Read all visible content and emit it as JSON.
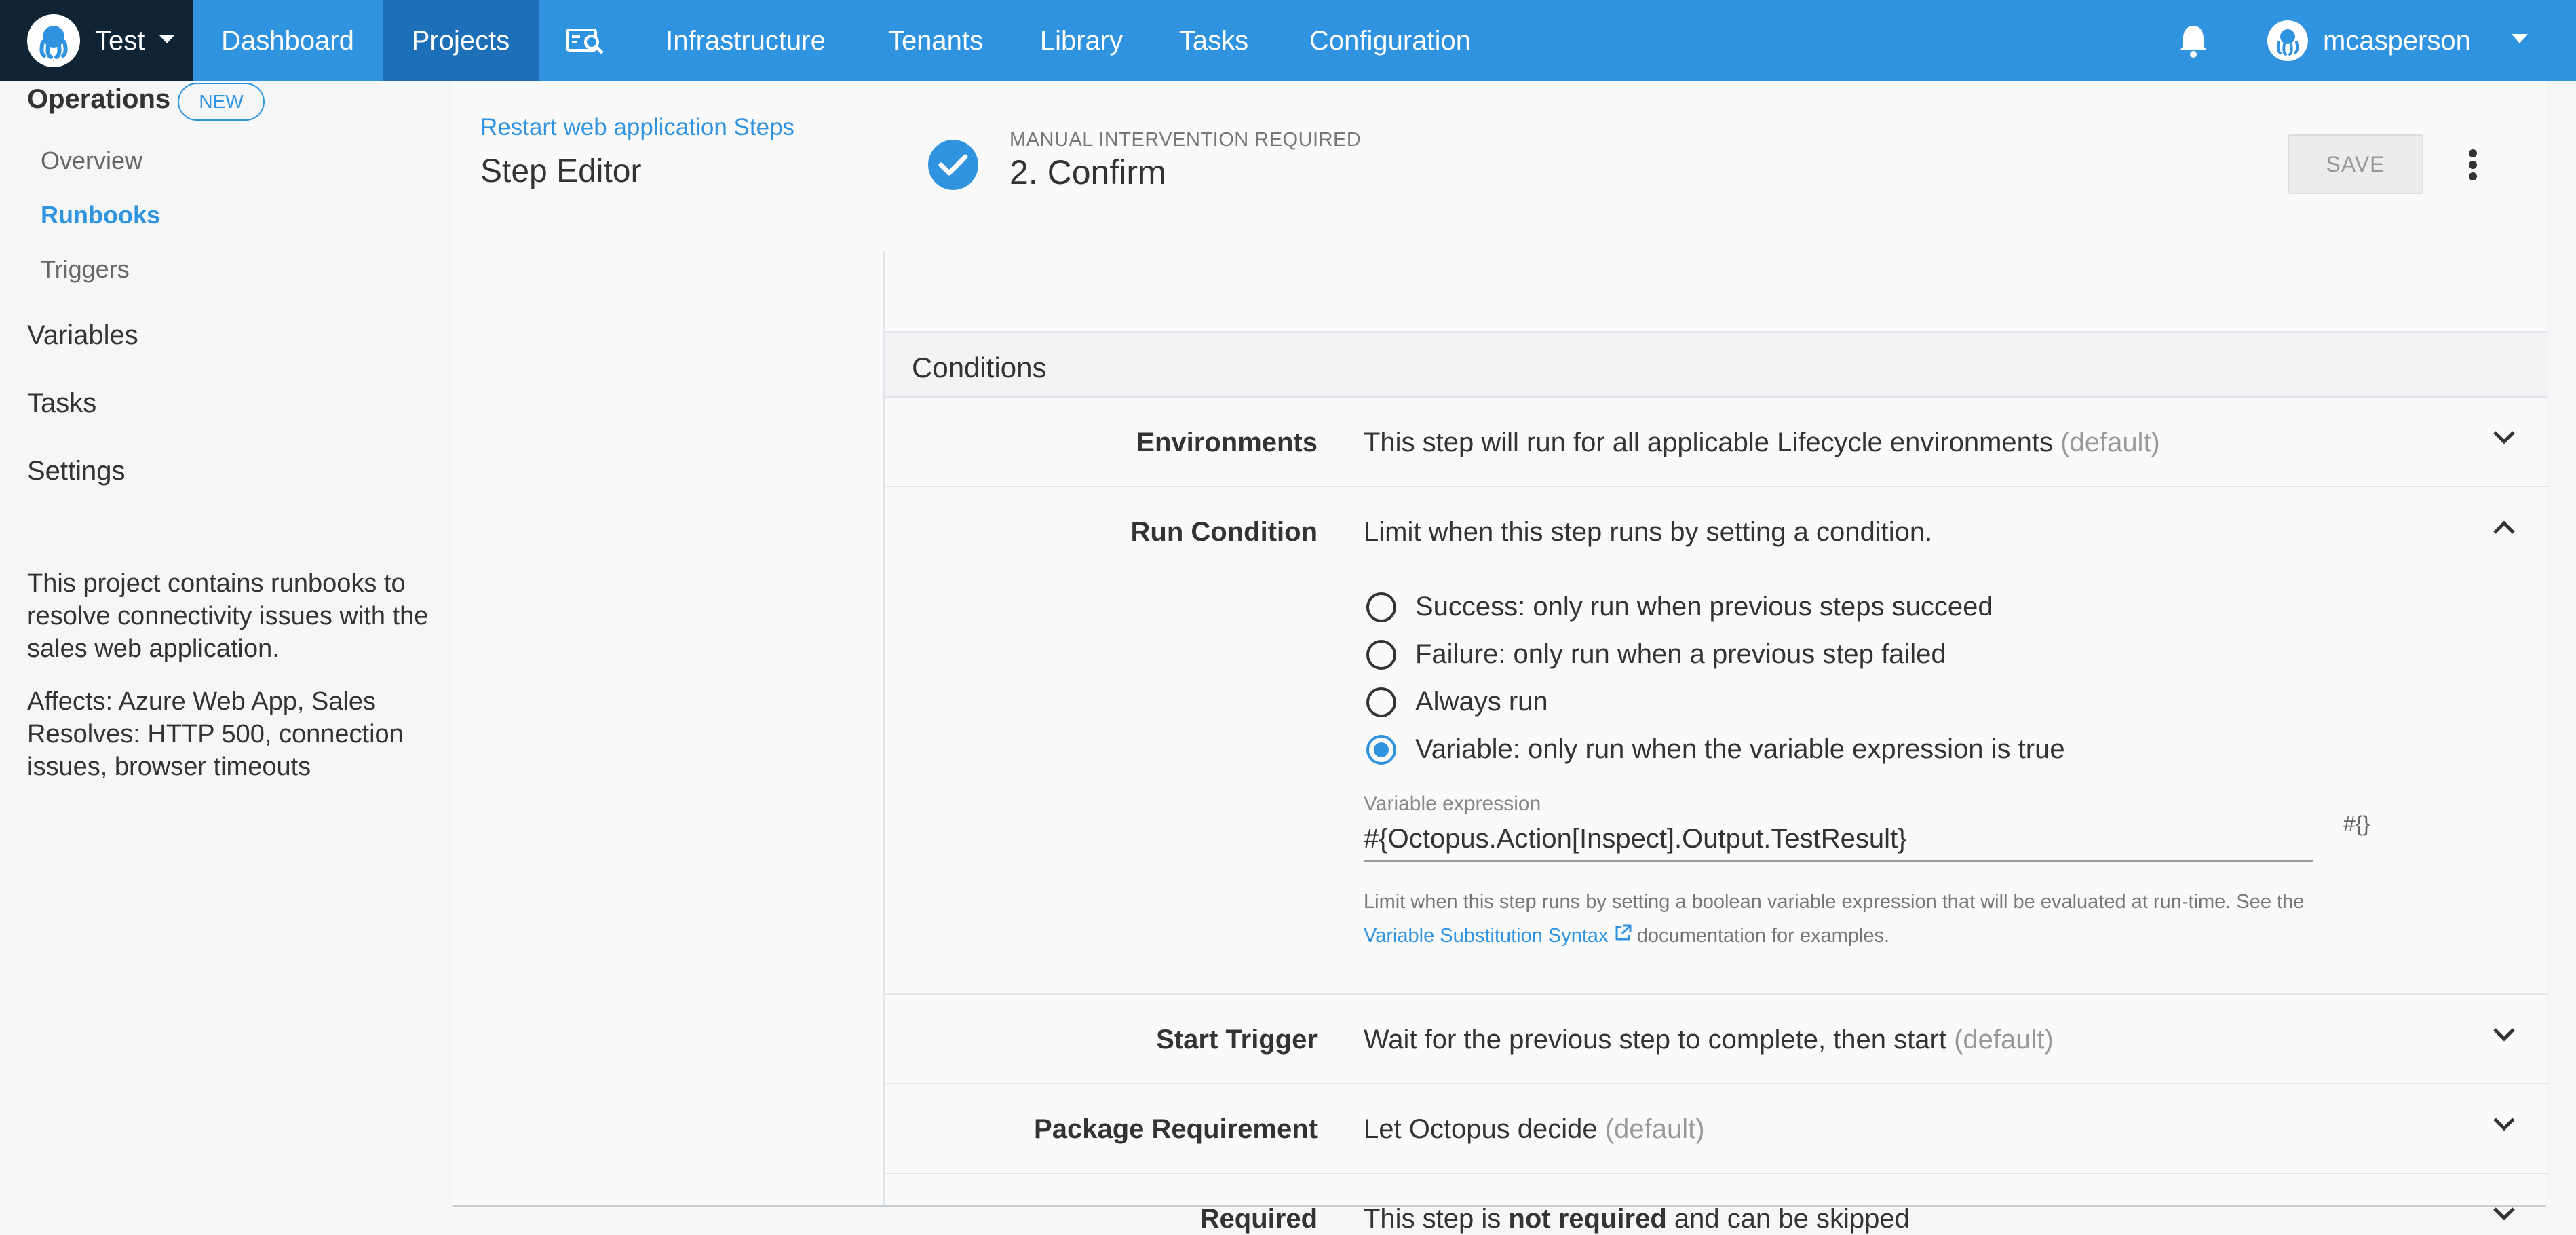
{
  "nav": {
    "space": "Test",
    "items": [
      "Dashboard",
      "Projects",
      "Infrastructure",
      "Tenants",
      "Library",
      "Tasks",
      "Configuration"
    ],
    "active": "Projects",
    "user": "mcasperson"
  },
  "sidebar": {
    "operations": "Operations",
    "badge": "NEW",
    "sub": [
      "Overview",
      "Runbooks",
      "Triggers"
    ],
    "active_sub": "Runbooks",
    "items": [
      "Variables",
      "Tasks",
      "Settings"
    ],
    "desc1": "This project contains runbooks to resolve connectivity issues with the sales web application.",
    "desc2": "Affects: Azure Web App, Sales",
    "desc3": "Resolves: HTTP 500, connection issues, browser timeouts"
  },
  "header": {
    "breadcrumb": "Restart web application Steps",
    "title": "Step Editor",
    "step_kind": "MANUAL INTERVENTION REQUIRED",
    "step_title": "2.  Confirm",
    "save": "SAVE"
  },
  "conditions": {
    "title": "Conditions",
    "environments": {
      "label": "Environments",
      "value": "This step will run for all applicable Lifecycle environments",
      "default": "(default)"
    },
    "run_condition": {
      "label": "Run Condition",
      "value": "Limit when this step runs by setting a condition.",
      "options": [
        "Success: only run when previous steps succeed",
        "Failure: only run when a previous step failed",
        "Always run",
        "Variable: only run when the variable expression is true"
      ],
      "selected": 3,
      "var_label": "Variable expression",
      "var_value": "#{Octopus.Action[Inspect].Output.TestResult}",
      "hash_btn": "#{}",
      "help_a": "Limit when this step runs by setting a boolean variable expression that will be evaluated at run-time. See the",
      "help_link": "Variable Substitution Syntax",
      "help_b": "documentation for examples."
    },
    "start_trigger": {
      "label": "Start Trigger",
      "value": "Wait for the previous step to complete, then start",
      "default": "(default)"
    },
    "package": {
      "label": "Package Requirement",
      "value": "Let Octopus decide",
      "default": "(default)"
    },
    "required": {
      "label": "Required",
      "pre": "This step is",
      "bold": "not required",
      "post": "and can be skipped"
    }
  },
  "colors": {
    "primary": "#2f93e0",
    "brand_dark": "#0f2536",
    "active_nav": "#1d6fb8"
  }
}
